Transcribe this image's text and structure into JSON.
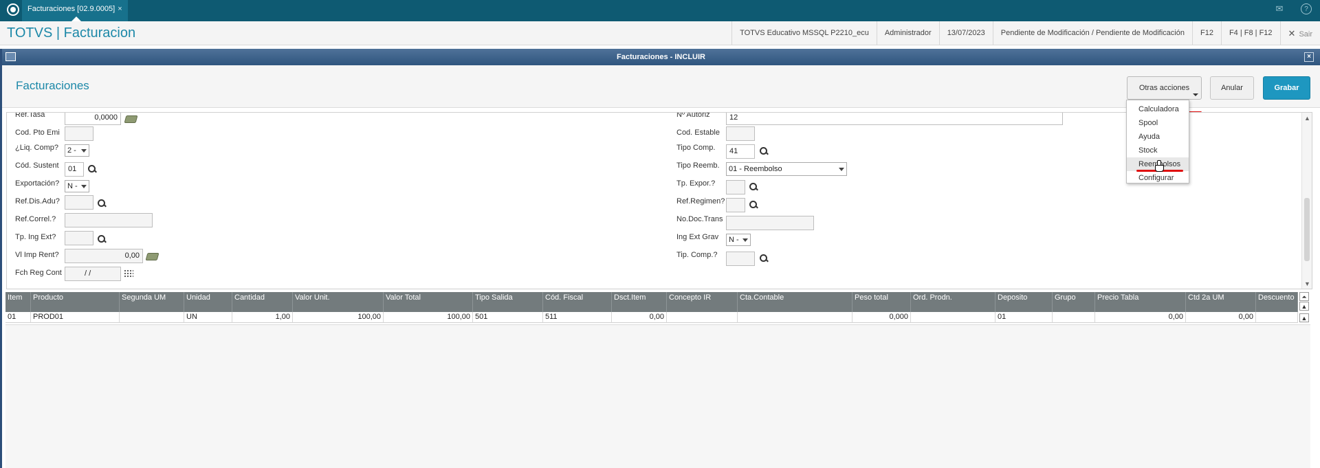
{
  "topbar": {
    "tab_label": "Facturaciones [02.9.0005]",
    "tab_close": "×",
    "mail_icon": "mail-icon",
    "help_icon": "?"
  },
  "app": {
    "title": "TOTVS | Facturacion",
    "env": "TOTVS Educativo MSSQL P2210_ecu",
    "user": "Administrador",
    "date": "13/07/2023",
    "status": "Pendiente de Modificación / Pendiente de Modificación",
    "key1": "F12",
    "key2": "F4 | F8 | F12",
    "exit": "Sair",
    "exit_icon": "✕"
  },
  "dialog": {
    "title": "Facturaciones - INCLUIR",
    "close": "×",
    "header_title": "Facturaciones",
    "btn_otras": "Otras acciones",
    "btn_anular": "Anular",
    "btn_grabar": "Grabar"
  },
  "menu": {
    "items": [
      "Calculadora",
      "Spool",
      "Ayuda",
      "Stock",
      "Reembolsos",
      "Configurar"
    ],
    "highlighted": "Reembolsos"
  },
  "form": {
    "left": {
      "ref_tasa_label": "Ref.Tasa",
      "ref_tasa_value": "0,0000",
      "cod_pto_emi_label": "Cod. Pto Emi",
      "cod_pto_emi_value": "",
      "liq_comp_label": "¿Liq. Comp?",
      "liq_comp_value": "2 -",
      "cod_sustent_label": "Cód. Sustent",
      "cod_sustent_value": "01",
      "exportacion_label": "Exportación?",
      "exportacion_value": "N -",
      "ref_dis_adu_label": "Ref.Dis.Adu?",
      "ref_dis_adu_value": "",
      "ref_correl_label": "Ref.Correl.?",
      "ref_correl_value": "",
      "tp_ing_ext_label": "Tp. Ing Ext?",
      "tp_ing_ext_value": "",
      "vl_imp_rent_label": "Vl Imp Rent?",
      "vl_imp_rent_value": "0,00",
      "fch_reg_cont_label": "Fch Reg Cont",
      "fch_reg_cont_value": "/ /"
    },
    "right": {
      "n_autoriz_label": "Nº Autoriz",
      "n_autoriz_value": "12",
      "cod_estable_label": "Cod. Estable",
      "cod_estable_value": "",
      "tipo_comp_label": "Tipo Comp.",
      "tipo_comp_value": "41",
      "tipo_reemb_label": "Tipo Reemb.",
      "tipo_reemb_value": "01 - Reembolso",
      "tp_expor_label": "Tp. Expor.?",
      "tp_expor_value": "",
      "ref_regimen_label": "Ref.Regimen?",
      "ref_regimen_value": "",
      "no_doc_trans_label": "No.Doc.Trans",
      "no_doc_trans_value": "",
      "ing_ext_grav_label": "Ing Ext Grav",
      "ing_ext_grav_value": "N -",
      "tip_comp_label": "Tip. Comp.?",
      "tip_comp_value": ""
    }
  },
  "grid": {
    "columns": [
      "Item",
      "Producto",
      "Segunda UM",
      "Unidad",
      "Cantidad",
      "Valor Unit.",
      "Valor Total",
      "Tipo Salida",
      "Cód. Fiscal",
      "Dsct.Item",
      "Concepto IR",
      "Cta.Contable",
      "Peso total",
      "Ord. Prodn.",
      "Deposito",
      "Grupo",
      "Precio Tabla",
      "Ctd 2a UM",
      "Descuento"
    ],
    "rows": [
      [
        "01",
        "PROD01",
        "",
        "UN",
        "1,00",
        "100,00",
        "100,00",
        "501",
        "511",
        "0,00",
        "",
        "",
        "0,000",
        "",
        "01",
        "",
        "0,00",
        "0,00",
        ""
      ]
    ]
  },
  "colors": {
    "accent": "#1c88a8",
    "topbar": "#0e5a72",
    "grabar": "#1e97c0",
    "highlight": "#e01010"
  }
}
